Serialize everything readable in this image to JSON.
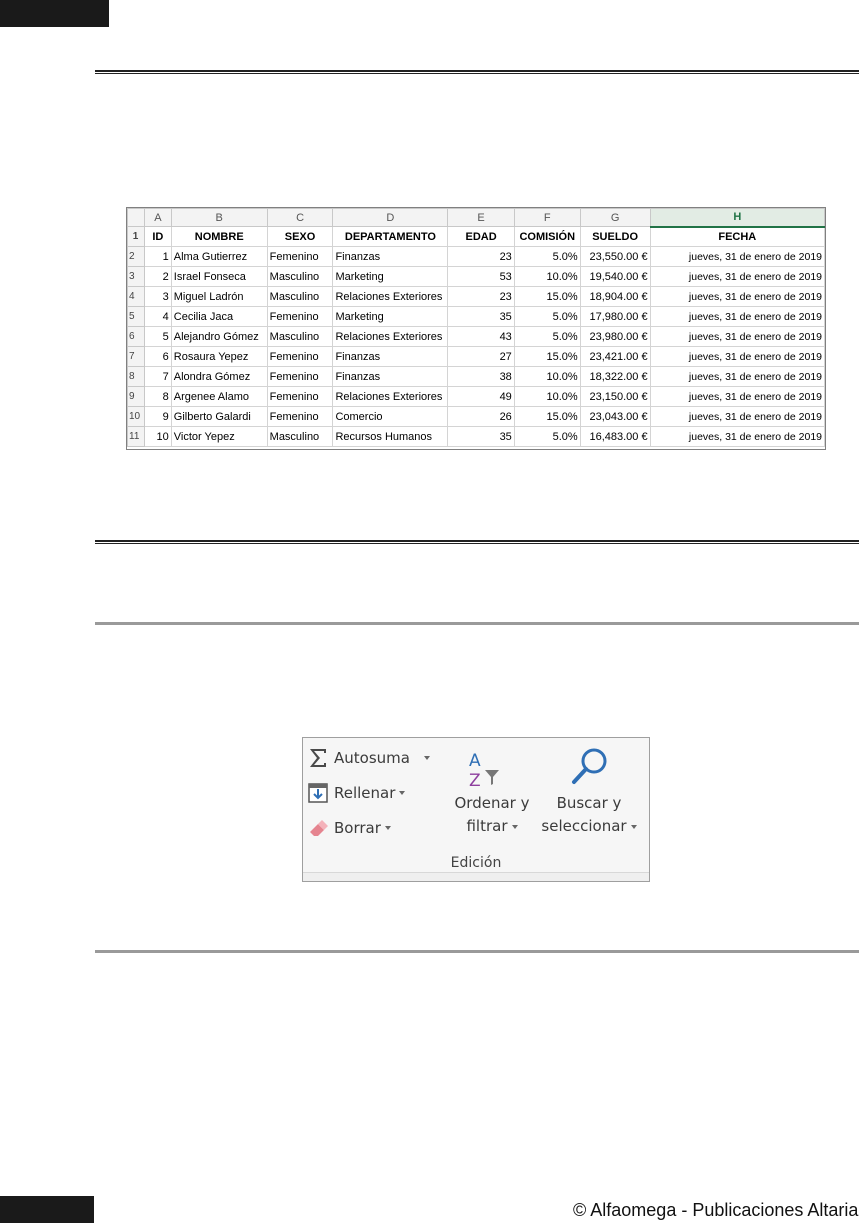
{
  "spreadsheet": {
    "columns": [
      "A",
      "B",
      "C",
      "D",
      "E",
      "F",
      "G",
      "H"
    ],
    "row_numbers": [
      "1",
      "2",
      "3",
      "4",
      "5",
      "6",
      "7",
      "8",
      "9",
      "10",
      "11"
    ],
    "headers": [
      "ID",
      "NOMBRE",
      "SEXO",
      "DEPARTAMENTO",
      "EDAD",
      "COMISIÓN",
      "SUELDO",
      "FECHA"
    ],
    "rows": [
      [
        "1",
        "Alma Gutierrez",
        "Femenino",
        "Finanzas",
        "23",
        "5.0%",
        "23,550.00 €",
        "jueves, 31 de enero de 2019"
      ],
      [
        "2",
        "Israel Fonseca",
        "Masculino",
        "Marketing",
        "53",
        "10.0%",
        "19,540.00 €",
        "jueves, 31 de enero de 2019"
      ],
      [
        "3",
        "Miguel Ladrón",
        "Masculino",
        "Relaciones Exteriores",
        "23",
        "15.0%",
        "18,904.00 €",
        "jueves, 31 de enero de 2019"
      ],
      [
        "4",
        "Cecilia Jaca",
        "Femenino",
        "Marketing",
        "35",
        "5.0%",
        "17,980.00 €",
        "jueves, 31 de enero de 2019"
      ],
      [
        "5",
        "Alejandro Gómez",
        "Masculino",
        "Relaciones Exteriores",
        "43",
        "5.0%",
        "23,980.00 €",
        "jueves, 31 de enero de 2019"
      ],
      [
        "6",
        "Rosaura Yepez",
        "Femenino",
        "Finanzas",
        "27",
        "15.0%",
        "23,421.00 €",
        "jueves, 31 de enero de 2019"
      ],
      [
        "7",
        "Alondra Gómez",
        "Femenino",
        "Finanzas",
        "38",
        "10.0%",
        "18,322.00 €",
        "jueves, 31 de enero de 2019"
      ],
      [
        "8",
        "Argenee Alamo",
        "Femenino",
        "Relaciones Exteriores",
        "49",
        "10.0%",
        "23,150.00 €",
        "jueves, 31 de enero de 2019"
      ],
      [
        "9",
        "Gilberto Galardi",
        "Femenino",
        "Comercio",
        "26",
        "15.0%",
        "23,043.00 €",
        "jueves, 31 de enero de 2019"
      ],
      [
        "10",
        "Victor Yepez",
        "Masculino",
        "Recursos Humanos",
        "35",
        "5.0%",
        "16,483.00 €",
        "jueves, 31 de enero de 2019"
      ]
    ]
  },
  "ribbon": {
    "autosuma": "Autosuma",
    "rellenar": "Rellenar",
    "borrar": "Borrar",
    "ordenar_line1": "Ordenar y",
    "ordenar_line2": "filtrar",
    "buscar_line1": "Buscar y",
    "buscar_line2": "seleccionar",
    "group_name": "Edición",
    "sort_icon_letters": [
      "A",
      "Z"
    ]
  },
  "footer": {
    "copyright": "© Alfaomega - Publicaciones Altaria"
  }
}
